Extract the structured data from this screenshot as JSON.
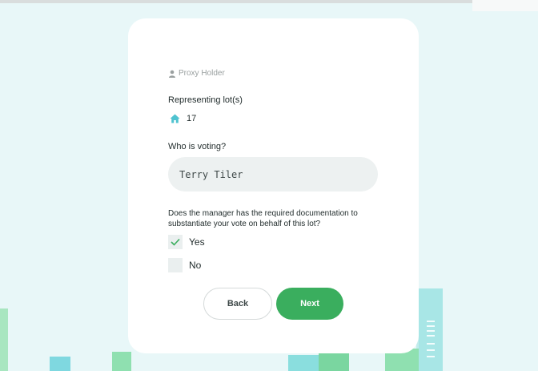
{
  "form": {
    "role_label": "Proxy Holder",
    "lots_heading": "Representing lot(s)",
    "lot_number": "17",
    "voter_heading": "Who is voting?",
    "voter_value": "Terry Tiler",
    "question": "Does the manager has the required documentation to substantiate your vote on behalf of this lot?",
    "options": [
      {
        "label": "Yes",
        "checked": true
      },
      {
        "label": "No",
        "checked": false
      }
    ],
    "back_label": "Back",
    "next_label": "Next"
  },
  "colors": {
    "background": "#e8f7f8",
    "card": "#ffffff",
    "accent_green": "#3aae5e",
    "lot_icon": "#4fc3d0",
    "input_bg": "#edf1f1"
  },
  "icons": {
    "role": "person-icon",
    "lot": "house-icon",
    "yes": "checkmark-icon"
  }
}
